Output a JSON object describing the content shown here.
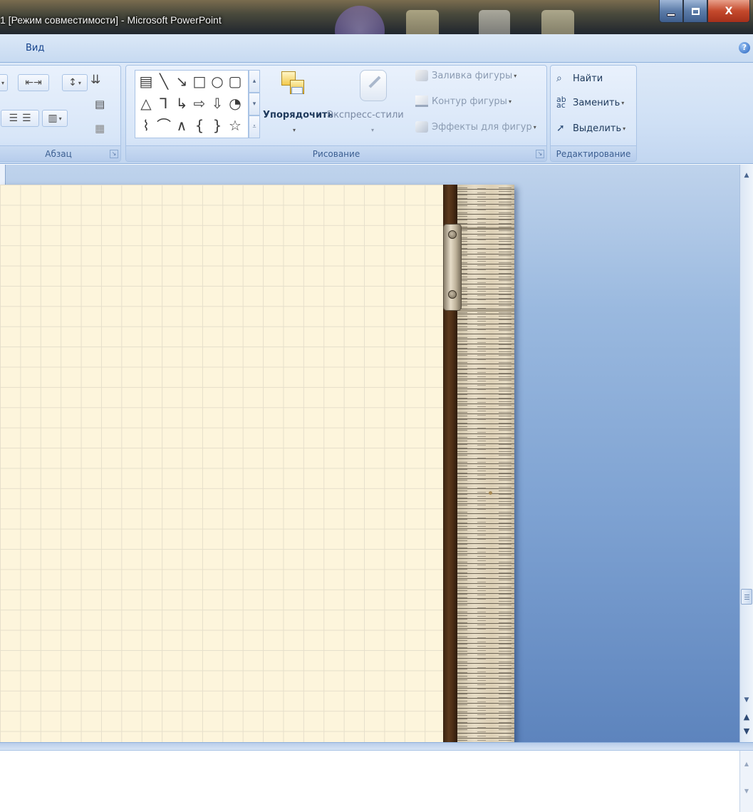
{
  "window": {
    "title": "1 [Режим совместимости] - Microsoft PowerPoint",
    "minimize_glyph": "",
    "close_glyph": "X"
  },
  "ribbon": {
    "tab_label": "Вид",
    "help_glyph": "?",
    "paragraph_group": {
      "label": "Абзац"
    },
    "drawing_group": {
      "label": "Рисование",
      "shape_rows": [
        [
          "▤",
          "╲",
          "↘",
          "□",
          "○",
          "▢"
        ],
        [
          "△",
          "⅂",
          "↳",
          "⇨",
          "⇩",
          "◔"
        ],
        [
          "⌇",
          "⌒",
          "∧",
          "{",
          "}",
          "☆"
        ]
      ],
      "arrange_label": "Упорядочить",
      "quick_styles_label": "Экспресс-стили",
      "shape_fill_label": "Заливка фигуры",
      "shape_outline_label": "Контур фигуры",
      "shape_effects_label": "Эффекты для фигур"
    },
    "editing_group": {
      "label": "Редактирование",
      "find_label": "Найти",
      "replace_label": "Заменить",
      "select_label": "Выделить"
    }
  },
  "scrollbar": {
    "prev_slide_glyph": "▲",
    "next_slide_glyph": "▼"
  },
  "colors": {
    "slide_background": "#fdf5dc",
    "grid_line": "#e6dfcb",
    "ribbon_text": "#1e395b",
    "workspace_blue": "#7ea2d2",
    "ruler_wood": "#5c3a1e"
  }
}
